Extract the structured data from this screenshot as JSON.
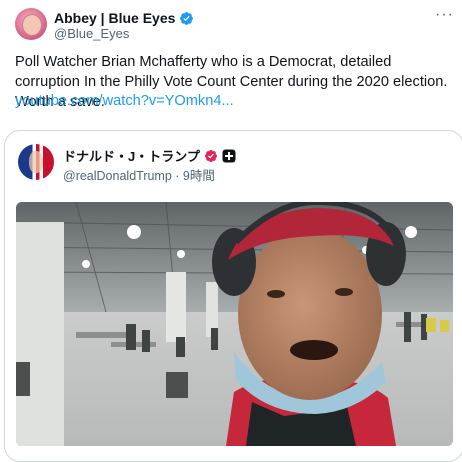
{
  "author": {
    "display_name": "Abbey | Blue Eyes",
    "handle": "@Blue_Eyes"
  },
  "tweet": {
    "text": "Poll Watcher Brian Mchafferty who is a Democrat, detailed corruption In the Philly Vote Count Center during the 2020 election. Worth a save.",
    "link": "youtube.com/watch?v=YOmkn4..."
  },
  "quoted": {
    "display_name": "ドナルド・J・トランプ",
    "meta": "@realDonaldTrump · 9時間"
  },
  "colors": {
    "link": "#1d9bf0",
    "verified_blue": "#1d9bf0",
    "verified_pink": "#e0245e",
    "muted": "#536471"
  },
  "icons": {
    "more": "more-horizontal-icon",
    "verified": "verified-badge-icon",
    "affiliate": "affiliate-badge-icon"
  }
}
